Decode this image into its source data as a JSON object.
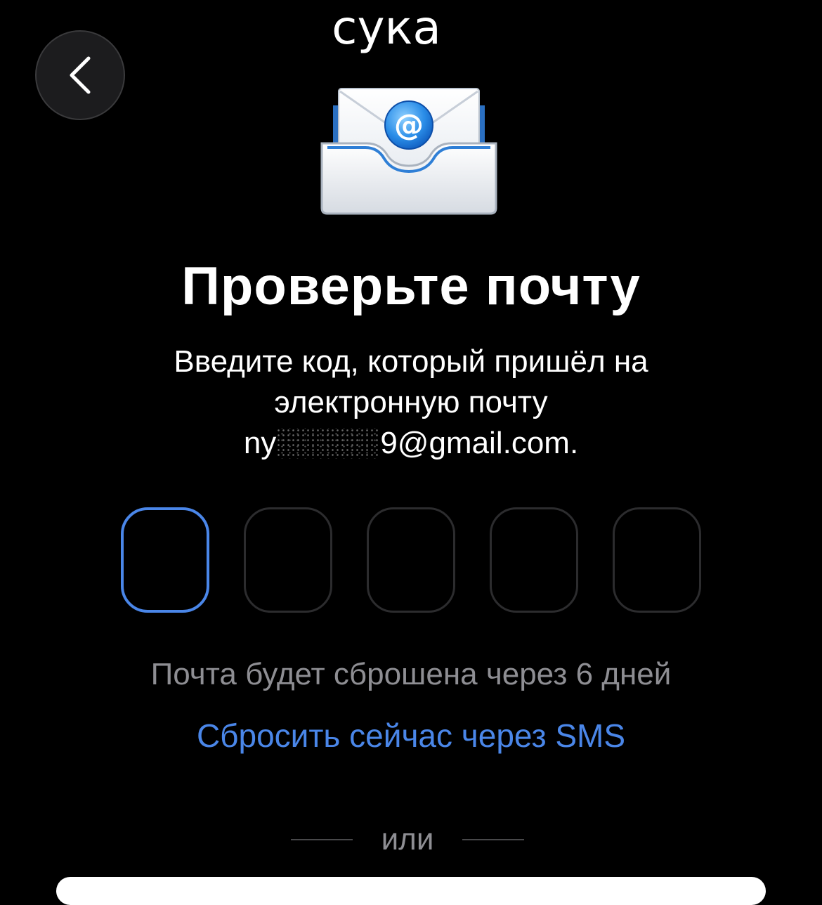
{
  "overlay": {
    "caption": "сука"
  },
  "header": {
    "back_icon": "chevron-left-icon"
  },
  "hero": {
    "icon": "envelope-at-icon",
    "at_symbol": "@"
  },
  "main": {
    "title": "Проверьте почту",
    "subtitle_line1": "Введите код, который пришёл на",
    "subtitle_line2": "электронную почту",
    "email_prefix": "ny",
    "email_suffix": "9@gmail.com."
  },
  "code_input": {
    "length": 5,
    "active_index": 0,
    "active_color": "#4a86e8",
    "inactive_color": "#2c2c2e"
  },
  "footer": {
    "reset_info": "Почта будет сброшена через 6 дней",
    "reset_link": "Сбросить сейчас через SMS",
    "divider_text": "или",
    "link_color": "#4a86e8"
  }
}
